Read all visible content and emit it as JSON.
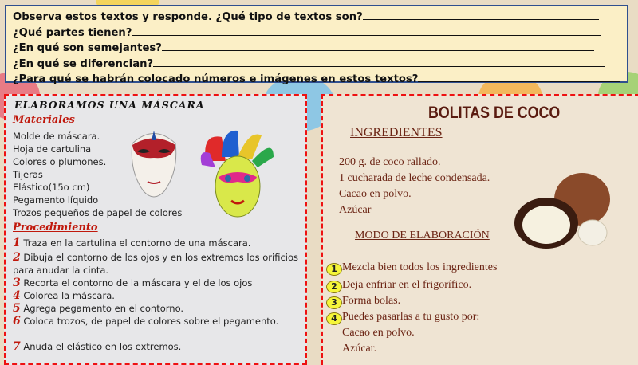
{
  "questions": [
    "Observa estos textos y responde. ¿Qué tipo de textos son?",
    "¿Qué partes tienen?",
    " ¿En qué son semejantes?",
    "¿En qué se diferencian?",
    "¿Para qué se habrán colocado números e imágenes en estos textos?"
  ],
  "mask": {
    "title": "ELABORAMOS UNA MÁSCARA",
    "materials_heading": "Materiales",
    "materials": [
      "Molde de máscara.",
      "Hoja de cartulina",
      "Colores o plumones.",
      "Tijeras",
      "Elástico(15o cm)",
      "Pegamento líquido",
      "Trozos pequeños de papel de colores"
    ],
    "procedure_heading": "Procedimiento",
    "steps": [
      {
        "n": "1",
        "text": "Traza en la cartulina el contorno de una máscara."
      },
      {
        "n": "2",
        "text": "Dibuja el contorno de los ojos y en los extremos los orificios para anudar la cinta."
      },
      {
        "n": "3",
        "text": "Recorta el contorno de la máscara y el de los ojos"
      },
      {
        "n": "4",
        "text": "Colorea la máscara."
      },
      {
        "n": "5",
        "text": "Agrega pegamento en el contorno."
      },
      {
        "n": "6",
        "text": "Coloca trozos, de papel de colores sobre el pegamento."
      },
      {
        "n": "7",
        "text": "Anuda el elástico en los extremos."
      }
    ]
  },
  "recipe": {
    "title": "BOLITAS DE COCO",
    "ingredients_heading": "INGREDIENTES",
    "ingredients": [
      "200 g. de coco rallado.",
      "1 cucharada de leche condensada.",
      "Cacao en polvo.",
      "Azúcar"
    ],
    "method_heading": "MODO DE ELABORACIÓN",
    "steps": [
      {
        "n": "1",
        "text": "Mezcla bien todos los ingredientes"
      },
      {
        "n": "2",
        "text": "Deja enfriar en el frigorífico."
      },
      {
        "n": "3",
        "text": "Forma bolas."
      },
      {
        "n": "4",
        "text": "Puedes pasarlas a tu gusto por:"
      }
    ],
    "options": [
      "Cacao en polvo.",
      "Azúcar."
    ]
  },
  "colors": {
    "accent_red": "#c0180c",
    "question_bg": "#fbefc6",
    "recipe_text": "#6b2414"
  }
}
